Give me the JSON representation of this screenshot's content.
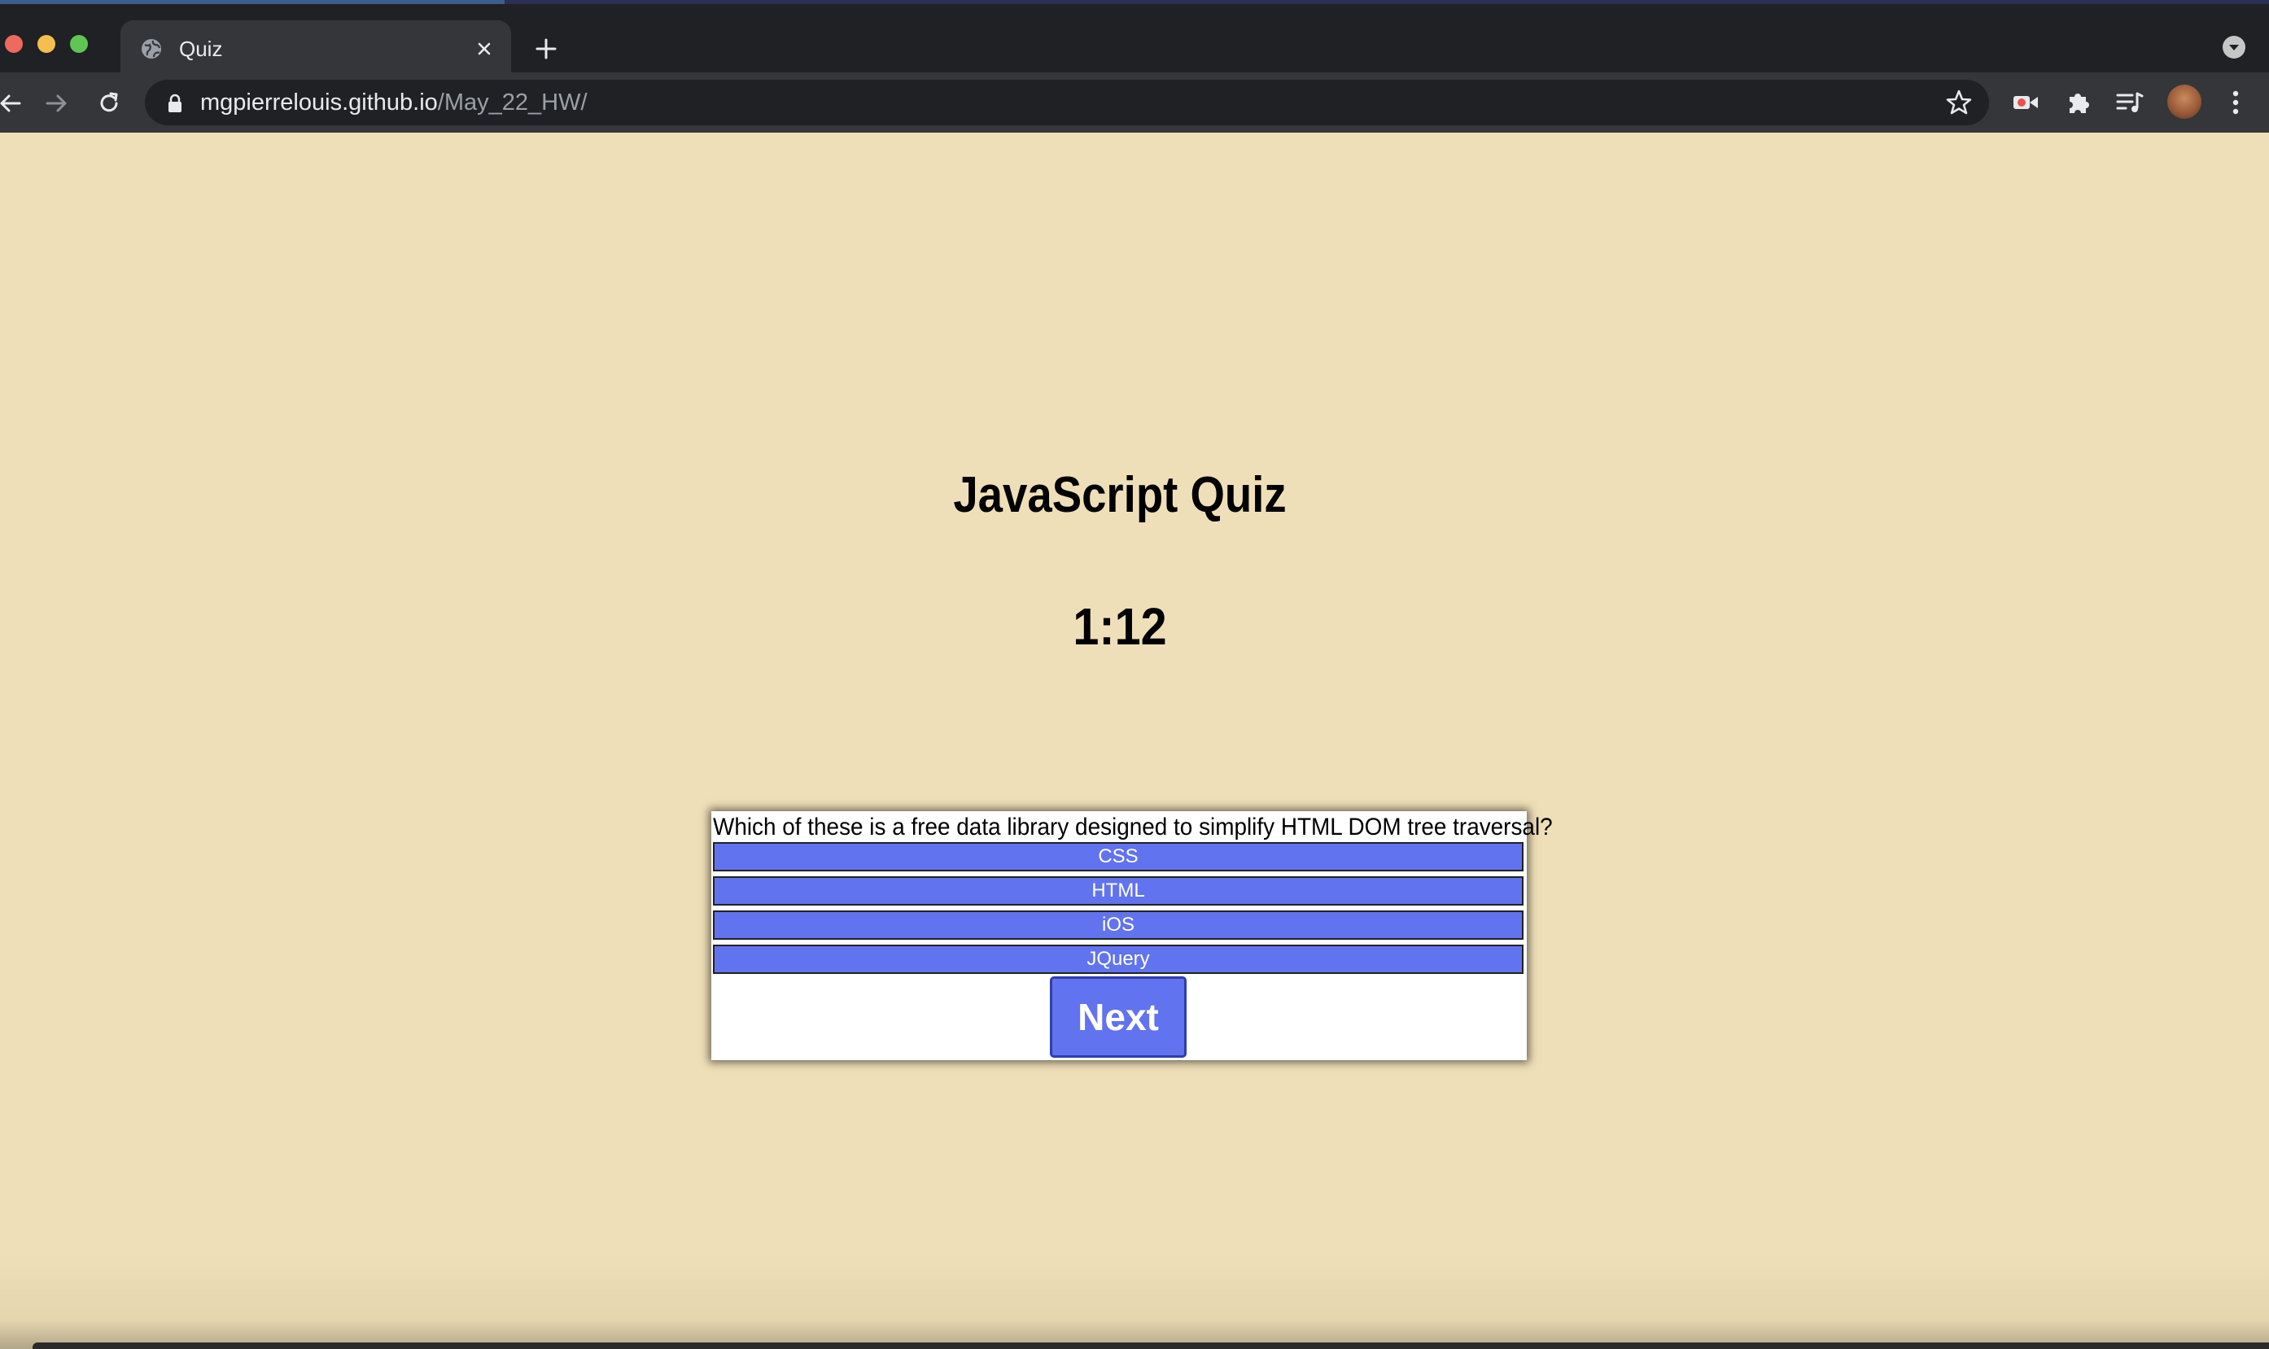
{
  "browser": {
    "tab_title": "Quiz",
    "url_host": "mgpierrelouis.github.io",
    "url_path": "/May_22_HW/"
  },
  "quiz": {
    "title": "JavaScript Quiz",
    "timer": "1:12",
    "question": "Which of these is a free data library designed to simplify HTML DOM tree traversal?",
    "answers": [
      "CSS",
      "HTML",
      "iOS",
      "JQuery"
    ],
    "next_label": "Next"
  },
  "colors": {
    "page_background": "#efdfb8",
    "answer_background": "#6173ee",
    "button_background": "#6173ee"
  }
}
